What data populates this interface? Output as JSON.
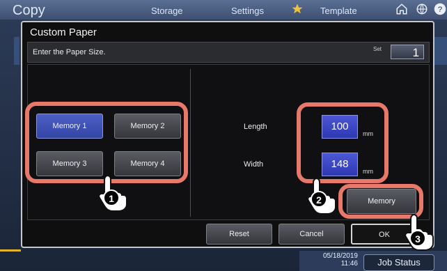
{
  "background": {
    "app_title": "Copy",
    "nav": [
      "Storage",
      "Settings",
      "Template"
    ],
    "date": "05/18/2019",
    "time": "11:46",
    "job_status": "Job Status",
    "icons": [
      "star-icon",
      "home-icon",
      "globe-icon",
      "help-icon"
    ]
  },
  "dialog": {
    "title": "Custom Paper",
    "instruction": "Enter the Paper Size.",
    "set_label": "Set",
    "set_value": "1",
    "memory_buttons": [
      "Memory 1",
      "Memory 2",
      "Memory 3",
      "Memory 4"
    ],
    "selected_memory": "Memory 1",
    "length_label": "Length",
    "length_value": "100",
    "width_label": "Width",
    "width_value": "148",
    "unit": "mm",
    "memory_label": "Memory",
    "reset_label": "Reset",
    "cancel_label": "Cancel",
    "ok_label": "OK"
  },
  "callouts": {
    "steps": [
      "1",
      "2",
      "3"
    ],
    "highlight_color": "#e8786a"
  }
}
